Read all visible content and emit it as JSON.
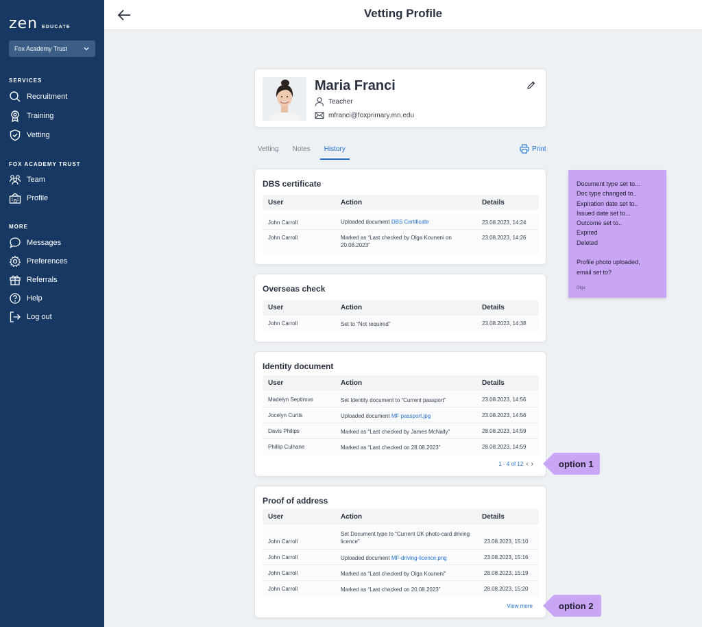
{
  "app": {
    "logo_main": "zen",
    "logo_sub": "EDUCATE",
    "org_select": "Fox Academy Trust"
  },
  "nav": {
    "services_heading": "SERVICES",
    "services": [
      {
        "label": "Recruitment"
      },
      {
        "label": "Training"
      },
      {
        "label": "Vetting"
      }
    ],
    "trust_heading": "FOX ACADEMY TRUST",
    "trust": [
      {
        "label": "Team"
      },
      {
        "label": "Profile"
      }
    ],
    "more_heading": "MORE",
    "more": [
      {
        "label": "Messages"
      },
      {
        "label": "Preferences"
      },
      {
        "label": "Referrals"
      },
      {
        "label": "Help"
      },
      {
        "label": "Log out"
      }
    ]
  },
  "header": {
    "title": "Vetting Profile"
  },
  "profile": {
    "name": "Maria Franci",
    "role": "Teacher",
    "email": "mfranci@foxprimary.mn.edu"
  },
  "tabs": [
    {
      "label": "Vetting"
    },
    {
      "label": "Notes"
    },
    {
      "label": "History"
    }
  ],
  "print_label": "Print",
  "columns": {
    "user": "User",
    "action": "Action",
    "details": "Details"
  },
  "sections": {
    "dbs": {
      "title": "DBS certificate",
      "rows": [
        {
          "user": "John Carroll",
          "action": "Uploaded document ",
          "link": "DBS Certificate",
          "details": "23.08.2023, 14:24"
        },
        {
          "user": "John Carroll",
          "action": "Marked as “Last checked by Olga Kouneni on 20.08.2023”",
          "details": "23.08.2023, 14:26"
        }
      ]
    },
    "overseas": {
      "title": "Overseas check",
      "rows": [
        {
          "user": "John Carroll",
          "action": "Set to “Not required”",
          "details": "23.08.2023, 14:38"
        }
      ]
    },
    "identity": {
      "title": "Identity document",
      "rows": [
        {
          "user": "Madelyn Septimus",
          "action": "Set Identity document to “Current passport”",
          "details": "23.08.2023, 14:56"
        },
        {
          "user": "Jocelyn Curtis",
          "action": "Uploaded document ",
          "link": "MF passport.jpg",
          "details": "23.08.2023, 14:56"
        },
        {
          "user": "Davis Philips",
          "action": "Marked as “Last checked by James McNally”",
          "details": "28.08.2023, 14:59"
        },
        {
          "user": "Phillip Culhane",
          "action": "Marked as “Last checked on 28.08.2023”",
          "details": "28.08.2023, 14:59"
        }
      ],
      "pager": "1 - 4 of 12"
    },
    "address": {
      "title": "Proof of address",
      "rows": [
        {
          "user": "John Carroll",
          "action": "Set Document type to “Current UK photo-card driving licence”",
          "details": "23.08.2023, 15:10"
        },
        {
          "user": "John Carroll",
          "action": "Uploaded document ",
          "link": "MF-driving-licence.png",
          "details": "23.08.2023, 15:16"
        },
        {
          "user": "John Carroll",
          "action": "Marked as “Last checked by Olga Kouneni”",
          "details": "28.08.2023, 15:19"
        },
        {
          "user": "John Carroll",
          "action": "Marked as “Last checked on 20.08.2023”",
          "details": "28.08.2023, 15:20"
        }
      ],
      "view_more": "View more"
    }
  },
  "sticky_note": {
    "lines": [
      "Document type set to...",
      "Doc type changed to..",
      "Expiration date set to..",
      "Issued date set to...",
      "Outcome set to..",
      "Expired",
      "Deleted",
      "",
      "Profile photo uploaded,",
      "email set to?"
    ],
    "author": "Olga"
  },
  "annotations": {
    "option1": "option 1",
    "option2": "option 2"
  },
  "colors": {
    "sidebar": "#173862",
    "accent": "#1f6fd0",
    "sticky": "#c9a5f5"
  }
}
